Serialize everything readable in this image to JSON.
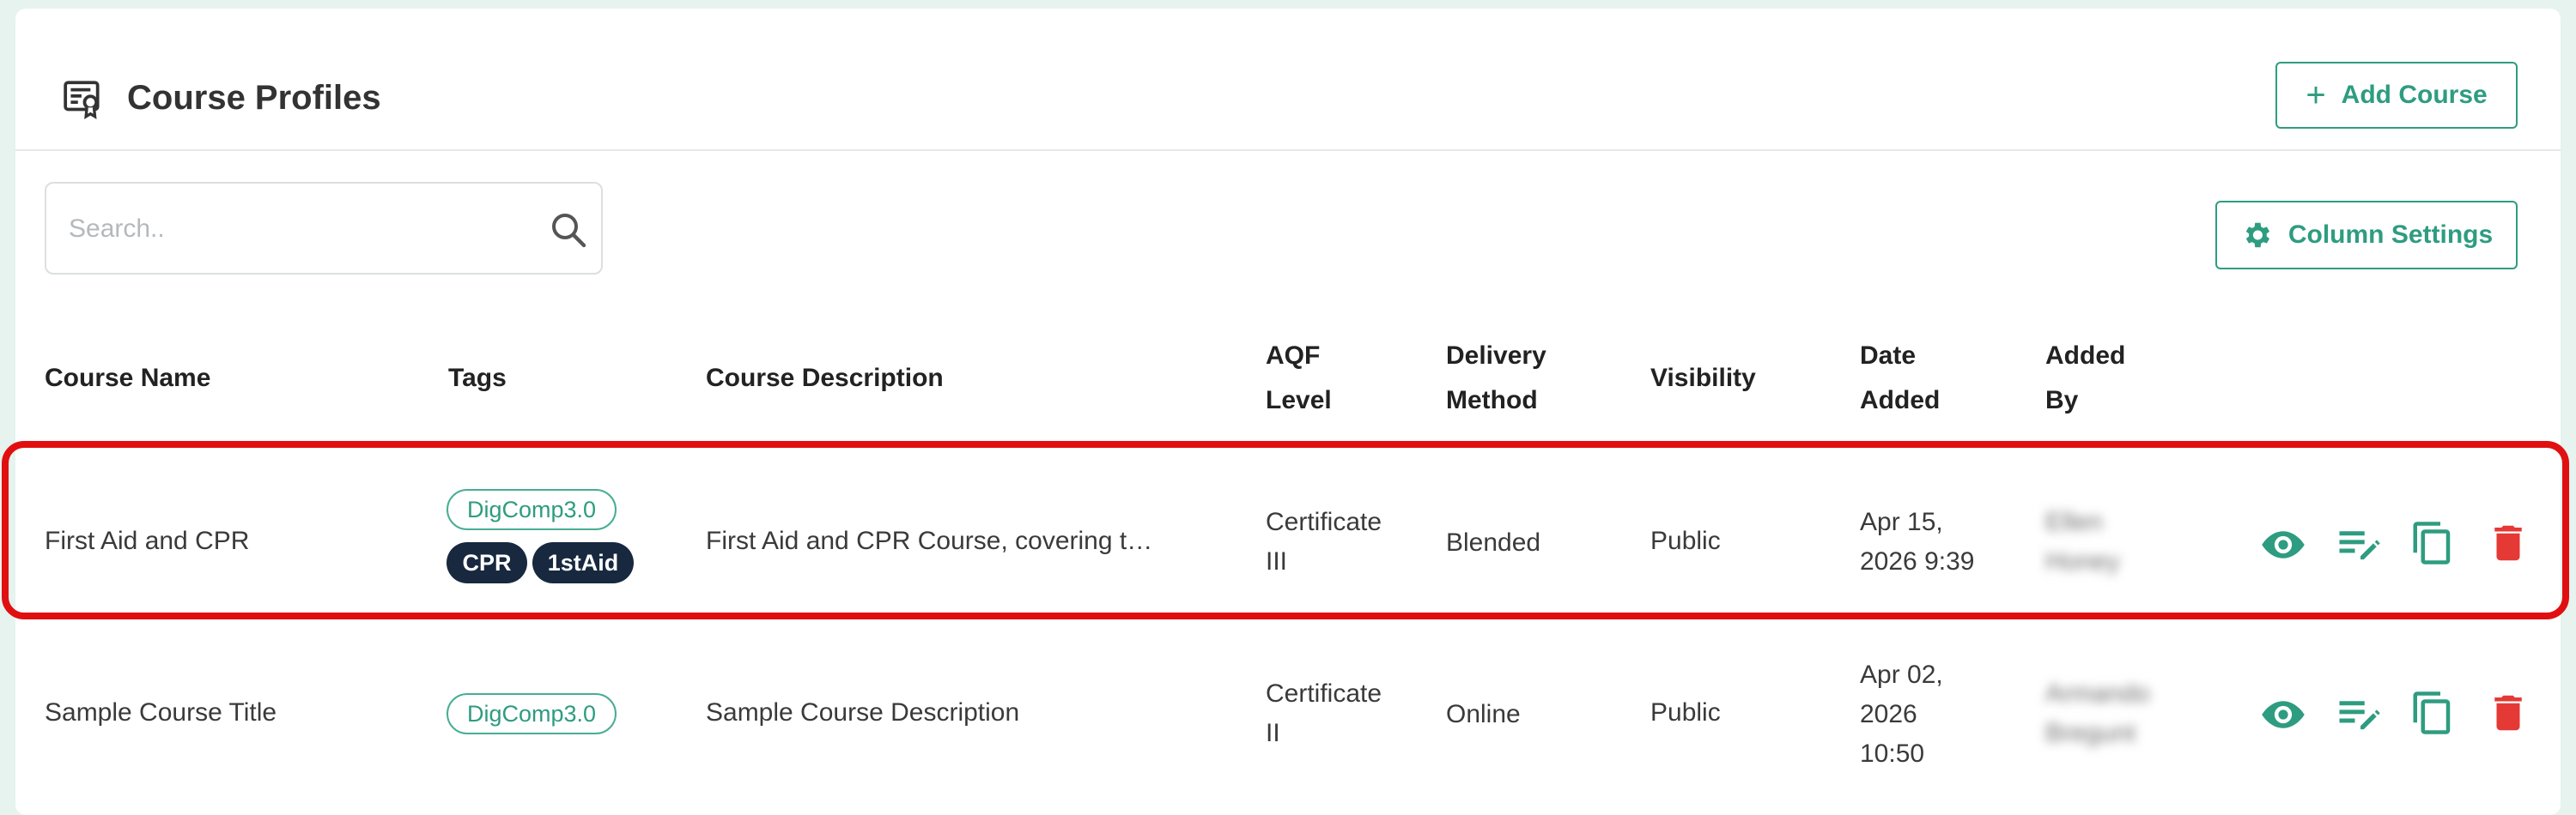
{
  "header": {
    "title": "Course Profiles",
    "title_icon": "certificate-icon",
    "add_button_label": "Add Course"
  },
  "toolbar": {
    "search_placeholder": "Search..",
    "column_settings_label": "Column Settings"
  },
  "table": {
    "columns": {
      "course_name": "Course Name",
      "tags": "Tags",
      "course_description": "Course Description",
      "aqf_level_1": "AQF",
      "aqf_level_2": "Level",
      "delivery_method_1": "Delivery",
      "delivery_method_2": "Method",
      "visibility": "Visibility",
      "date_added_1": "Date",
      "date_added_2": "Added",
      "added_by_1": "Added",
      "added_by_2": "By"
    },
    "rows": [
      {
        "course_name": "First Aid and CPR",
        "tags": [
          "DigComp3.0",
          "CPR",
          "1stAid"
        ],
        "course_description": "First Aid and CPR Course, covering t…",
        "aqf_level_1": "Certificate",
        "aqf_level_2": "III",
        "delivery_method": "Blended",
        "visibility": "Public",
        "date_added_1": "Apr 15,",
        "date_added_2": "2026 9:39",
        "added_by_1": "Ellen",
        "added_by_2": "Honey",
        "highlighted": true
      },
      {
        "course_name": "Sample Course Title",
        "tags": [
          "DigComp3.0"
        ],
        "course_description": "Sample Course Description",
        "aqf_level_1": "Certificate",
        "aqf_level_2": "II",
        "delivery_method": "Online",
        "visibility": "Public",
        "date_added_1": "Apr 02,",
        "date_added_2": "2026",
        "date_added_3": "10:50",
        "added_by_1": "Armando",
        "added_by_2": "Bregunt",
        "highlighted": false
      }
    ],
    "row_actions": [
      "eye-icon",
      "edit-list-icon",
      "copy-icon",
      "trash-icon"
    ]
  },
  "colors": {
    "accent": "#2e9c80",
    "danger": "#e53935",
    "tag_dark": "#17283f",
    "highlight": "#e01010"
  }
}
